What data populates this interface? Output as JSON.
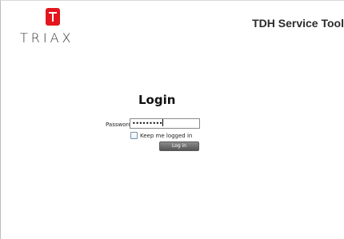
{
  "brand": {
    "logo_text": "TRIAX",
    "accent_color": "#e3161d",
    "logo_icon": "triax-t-logo-icon"
  },
  "header": {
    "title": "TDH Service Tool"
  },
  "login": {
    "heading": "Login",
    "password_label": "Password",
    "password_value": "•••••••••",
    "remember_label": "Keep me logged in",
    "remember_checked": false,
    "submit_label": "Log in"
  }
}
